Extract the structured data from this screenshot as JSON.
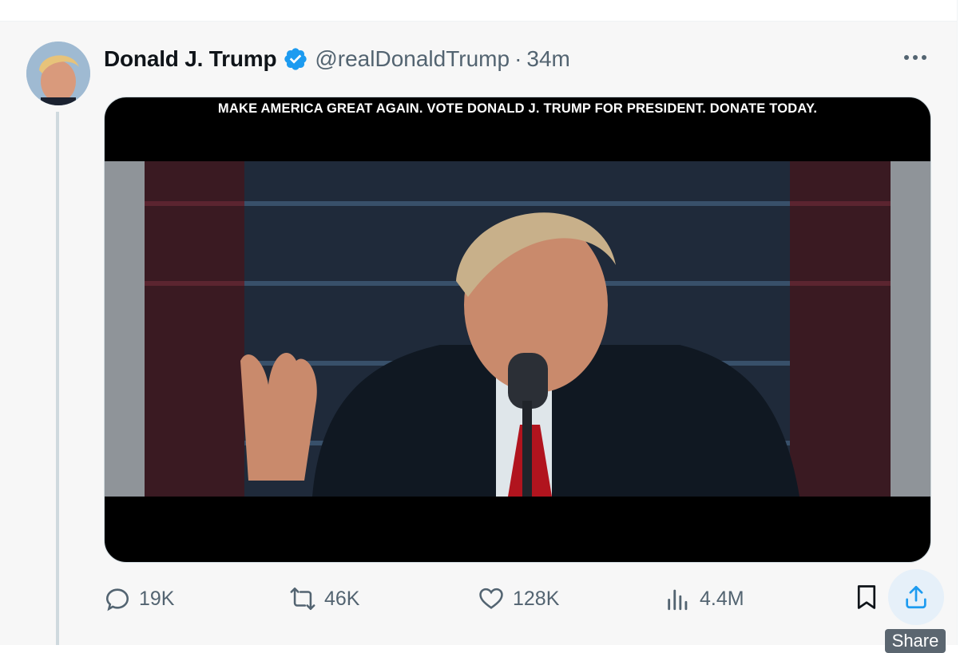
{
  "post": {
    "author_name": "Donald J. Trump",
    "handle": "@realDonaldTrump",
    "separator": "·",
    "time": "34m",
    "media_caption": "MAKE AMERICA GREAT AGAIN. VOTE DONALD J. TRUMP FOR PRESIDENT. DONATE TODAY."
  },
  "actions": {
    "replies": "19K",
    "reposts": "46K",
    "likes": "128K",
    "views": "4.4M"
  },
  "tooltip": {
    "share": "Share"
  },
  "icons": {
    "verified": "verified-badge-icon",
    "more": "more-options-icon",
    "reply": "reply-icon",
    "repost": "repost-icon",
    "like": "heart-icon",
    "views": "analytics-icon",
    "bookmark": "bookmark-icon",
    "share": "share-icon"
  },
  "colors": {
    "verified_blue": "#1d9bf0",
    "muted_text": "#536471",
    "primary_text": "#0f1419",
    "share_hover_bg": "#e6f0f9"
  }
}
